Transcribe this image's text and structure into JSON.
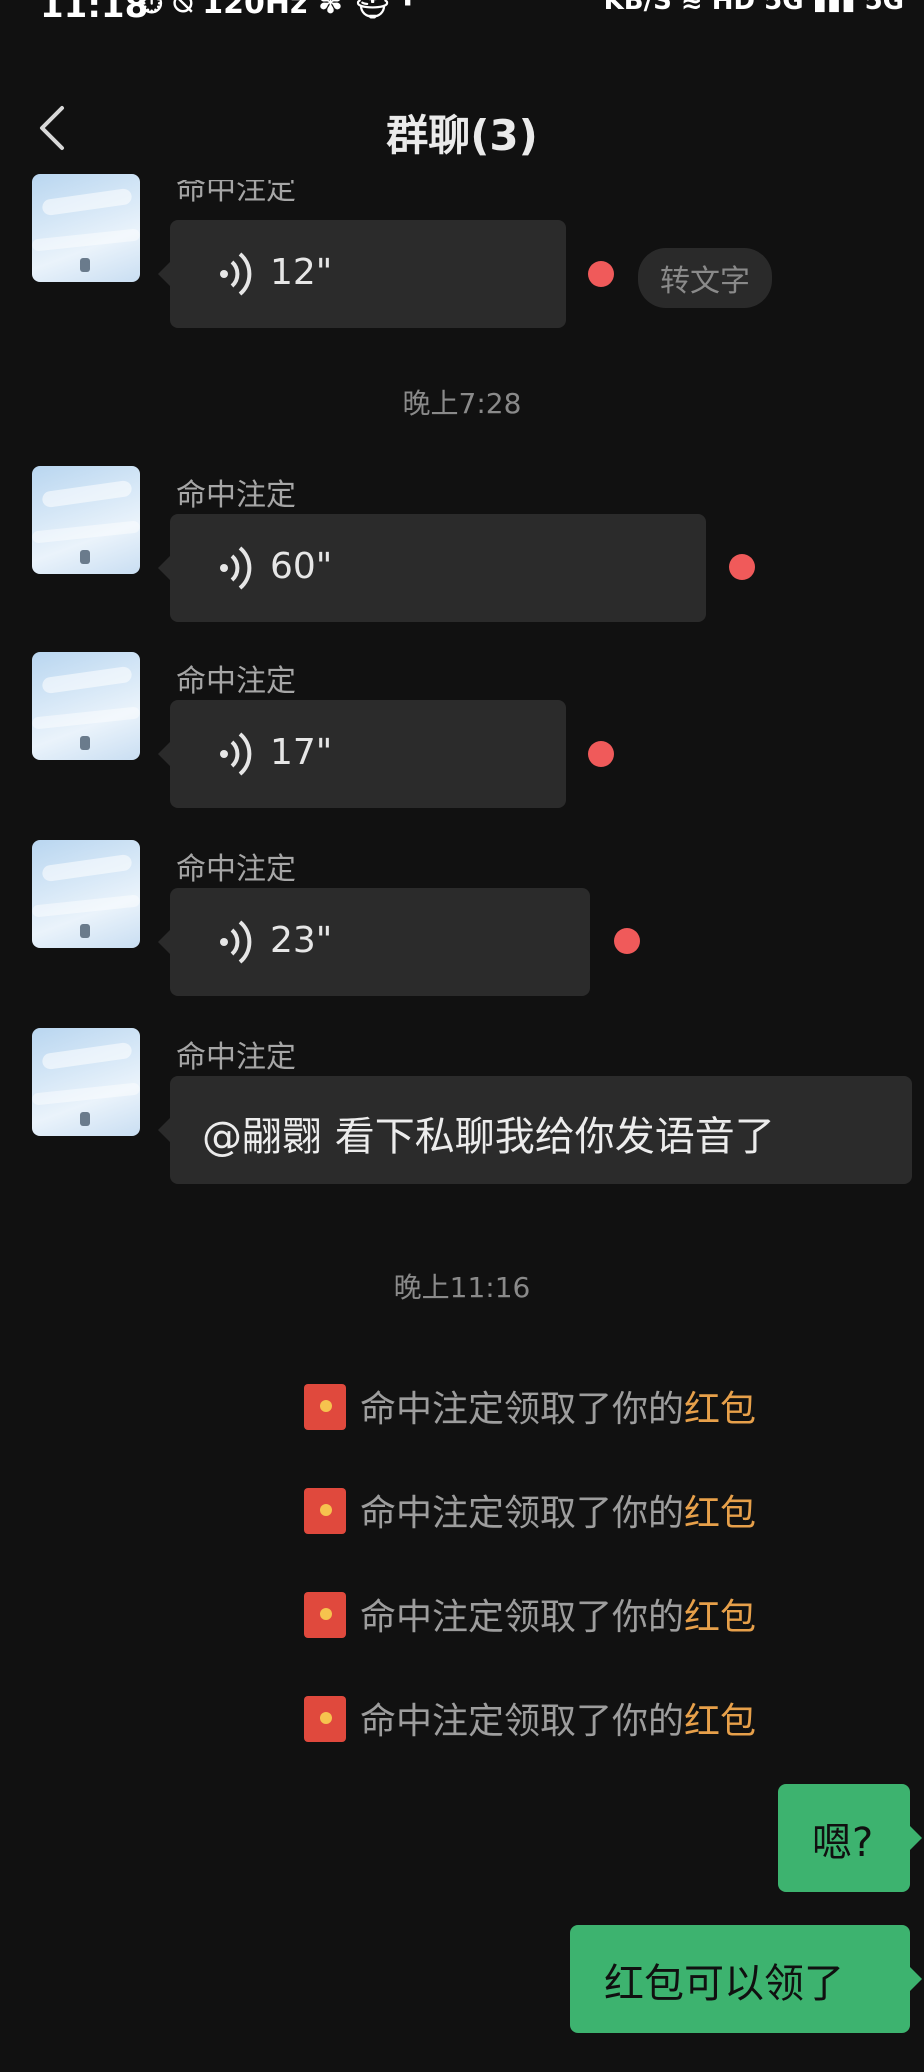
{
  "status_bar": {
    "time": "11:18",
    "left_icons": "⏱ ⍉ 120Hz ✽ ⛑ ·",
    "right_icons": "KB/S ≋ HD 5G ▮▮▮ 5G"
  },
  "header": {
    "title": "群聊(3)"
  },
  "messages": [
    {
      "sender": "命中注定",
      "duration": "12\"",
      "to_text": "转文字"
    },
    {
      "timestamp": "晚上7:28"
    },
    {
      "sender": "命中注定",
      "duration": "60\""
    },
    {
      "sender": "命中注定",
      "duration": "17\""
    },
    {
      "sender": "命中注定",
      "duration": "23\""
    },
    {
      "sender": "命中注定",
      "text": "@翤翾  看下私聊我给你发语音了"
    },
    {
      "timestamp": "晚上11:16"
    }
  ],
  "system_notices": [
    {
      "text": "命中注定领取了你的",
      "highlight": "红包"
    },
    {
      "text": "命中注定领取了你的",
      "highlight": "红包"
    },
    {
      "text": "命中注定领取了你的",
      "highlight": "红包"
    },
    {
      "text": "命中注定领取了你的",
      "highlight": "红包"
    }
  ],
  "outgoing": [
    {
      "text": "嗯?"
    },
    {
      "text": "红包可以领了"
    }
  ],
  "colors": {
    "background": "#111111",
    "bubble_incoming": "#2b2b2b",
    "bubble_outgoing": "#3db36f",
    "unread_dot": "#f05a5a",
    "red_packet_highlight": "#e7a04a"
  }
}
